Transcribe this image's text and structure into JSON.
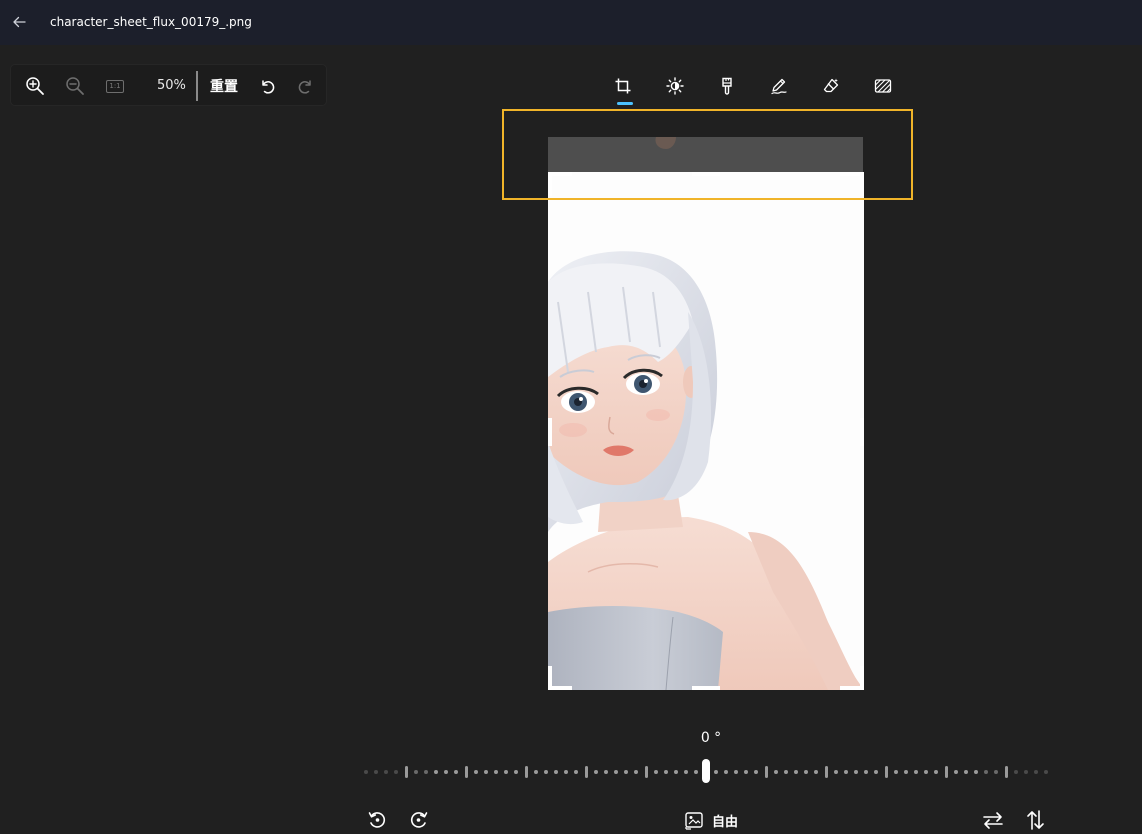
{
  "window": {
    "title": "character_sheet_flux_00179_.png"
  },
  "zoom_panel": {
    "zoom_in_icon": "zoom-in-icon",
    "zoom_out_icon": "zoom-out-icon",
    "actual_size_label": "1:1",
    "zoom_level": "50%",
    "reset_label": "重置",
    "undo_icon": "undo-icon",
    "redo_icon": "redo-icon"
  },
  "tools": [
    {
      "name": "crop",
      "icon": "crop-icon",
      "active": true
    },
    {
      "name": "adjust",
      "icon": "brightness-icon",
      "active": false
    },
    {
      "name": "filter",
      "icon": "filter-brush-icon",
      "active": false
    },
    {
      "name": "markup",
      "icon": "pen-icon",
      "active": false
    },
    {
      "name": "erase",
      "icon": "eraser-icon",
      "active": false
    },
    {
      "name": "background",
      "icon": "background-blur-icon",
      "active": false
    }
  ],
  "rotation": {
    "angle": "0 °",
    "value": 0
  },
  "bottom_bar": {
    "aspect_ratio_label": "自由"
  },
  "colors": {
    "background": "#202020",
    "titlebar": "#1c1f2b",
    "accent": "#4cc2ff",
    "highlight": "#f0b429"
  }
}
